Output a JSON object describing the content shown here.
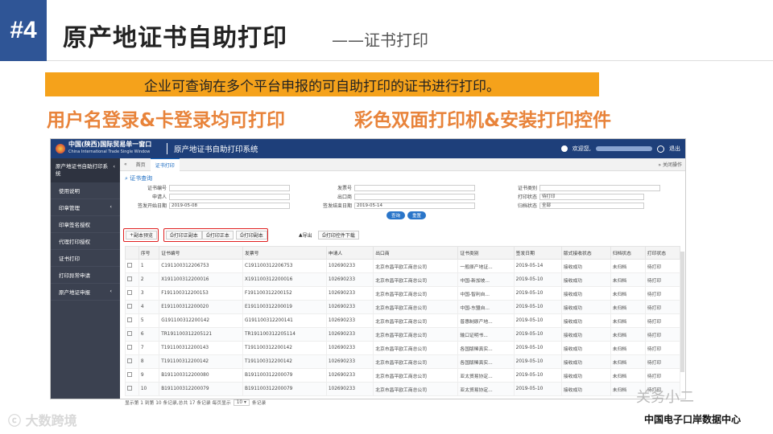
{
  "slide": {
    "number": "#4",
    "title": "原产地证书自助打印",
    "subtitle": "——证书打印",
    "banner": "企业可查询在多个平台申报的可自助打印的证书进行打印。",
    "feature_left": "用户名登录&卡登录均可打印",
    "feature_right": "彩色双面打印机&安装打印控件",
    "watermark_left": "大数跨境",
    "watermark_right": "关务小二",
    "footer_org": "中国电子口岸数据中心"
  },
  "app": {
    "brand_cn": "中国(陕西)国际贸易单一窗口",
    "brand_en": "China International Trade Single Window",
    "system_title": "原产地证书自助打印系统",
    "user_greeting": "欢迎您,",
    "logout": "退出",
    "colors": {
      "header": "#1e3f7a",
      "sidebar": "#3b4150",
      "accent": "#1a6bc2",
      "highlight": "#e02020"
    }
  },
  "sidebar": {
    "title": "原产地证书自助打印系统",
    "items": [
      {
        "label": "使用说明"
      },
      {
        "label": "印章管理"
      },
      {
        "label": "印章签名授权"
      },
      {
        "label": "代理打印授权"
      },
      {
        "label": "证书打印"
      },
      {
        "label": "打印异常申请"
      },
      {
        "label": "原产地证申报"
      }
    ]
  },
  "tabs": {
    "home": "首页",
    "active": "证书打印",
    "close_ops": "关闭操作"
  },
  "query": {
    "title": "证书查询",
    "fields": {
      "cert_no": "证书编号",
      "invoice_no": "发票号",
      "cert_type": "证书类别",
      "applicant": "申请人",
      "exporter": "出口商",
      "print_status": "打印状态",
      "print_status_value": "待打印",
      "issue_start": "签发开始日期",
      "issue_start_value": "2019-05-08",
      "issue_end": "签发结束日期",
      "issue_end_value": "2019-05-14",
      "archive_status": "归档状态",
      "archive_status_value": "全部"
    },
    "btn_query": "查询",
    "btn_reset": "重置"
  },
  "toolbar": {
    "preview": "副本预览",
    "print_cert_copy": "打印正副本",
    "print_original": "打印正本",
    "print_copy": "打印副本",
    "export": "导出",
    "download_plugin": "打印控件下载"
  },
  "table": {
    "headers": [
      "",
      "序号",
      "证书编号",
      "发票号",
      "申请人",
      "出口商",
      "证书类别",
      "签发日期",
      "版式接收状态",
      "归档状态",
      "打印状态"
    ],
    "rows": [
      {
        "no": "1",
        "cert": "C191100312206753",
        "invoice": "C191100312206753",
        "applicant": "102690233",
        "exporter": "北京市昌平欧工商总公司",
        "type": "一般原产地证...",
        "date": "2019-05-14",
        "recv": "接收成功",
        "archive": "未归档",
        "print": "待打印"
      },
      {
        "no": "2",
        "cert": "X191100312200016",
        "invoice": "X191100312200016",
        "applicant": "102690233",
        "exporter": "北京市昌平欧工商总公司",
        "type": "中国-新加坡...",
        "date": "2019-05-10",
        "recv": "接收成功",
        "archive": "未归档",
        "print": "待打印"
      },
      {
        "no": "3",
        "cert": "F191100312200153",
        "invoice": "F191100312200152",
        "applicant": "102690233",
        "exporter": "北京市昌平欧工商总公司",
        "type": "中国-智利自...",
        "date": "2019-05-10",
        "recv": "接收成功",
        "archive": "未归档",
        "print": "待打印"
      },
      {
        "no": "4",
        "cert": "E191100312200020",
        "invoice": "E191100312200019",
        "applicant": "102690233",
        "exporter": "北京市昌平欧工商总公司",
        "type": "中国-东盟自...",
        "date": "2019-05-10",
        "recv": "接收成功",
        "archive": "未归档",
        "print": "待打印"
      },
      {
        "no": "5",
        "cert": "G191100312200142",
        "invoice": "G191100312200141",
        "applicant": "102690233",
        "exporter": "北京市昌平欧工商总公司",
        "type": "普惠制原产地...",
        "date": "2019-05-10",
        "recv": "接收成功",
        "archive": "未归档",
        "print": "待打印"
      },
      {
        "no": "6",
        "cert": "TR191100312205121",
        "invoice": "TR191100312205114",
        "applicant": "102690233",
        "exporter": "北京市昌平欧工商总公司",
        "type": "输口证明书...",
        "date": "2019-05-10",
        "recv": "接收成功",
        "archive": "未归档",
        "print": "待打印"
      },
      {
        "no": "7",
        "cert": "T191100312200143",
        "invoice": "T191100312200142",
        "applicant": "102690233",
        "exporter": "北京市昌平欧工商总公司",
        "type": "各国版稀真实...",
        "date": "2019-05-10",
        "recv": "接收成功",
        "archive": "未归档",
        "print": "待打印"
      },
      {
        "no": "8",
        "cert": "T191100312200142",
        "invoice": "T191100312200142",
        "applicant": "102690233",
        "exporter": "北京市昌平欧工商总公司",
        "type": "各国版稀真实...",
        "date": "2019-05-10",
        "recv": "接收成功",
        "archive": "未归档",
        "print": "待打印"
      },
      {
        "no": "9",
        "cert": "B191100312200080",
        "invoice": "B191100312200079",
        "applicant": "102690233",
        "exporter": "北京市昌平欧工商总公司",
        "type": "亚太贸易协定...",
        "date": "2019-05-10",
        "recv": "接收成功",
        "archive": "未归档",
        "print": "待打印"
      },
      {
        "no": "10",
        "cert": "B191100312200079",
        "invoice": "B191100312200079",
        "applicant": "102690233",
        "exporter": "北京市昌平欧工商总公司",
        "type": "亚太贸易协定...",
        "date": "2019-05-10",
        "recv": "接收成功",
        "archive": "未归档",
        "print": "待打印"
      }
    ]
  },
  "pager": {
    "info": "显示第 1 到第 10 条记录,总共 17 条记录 每页显示",
    "page_size": "10",
    "suffix": "条记录"
  }
}
